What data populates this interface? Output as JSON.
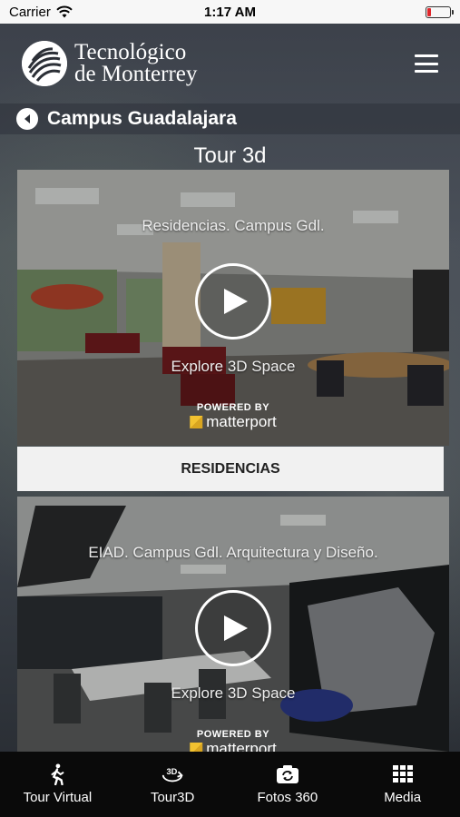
{
  "status_bar": {
    "carrier": "Carrier",
    "time": "1:17 AM"
  },
  "header": {
    "logo_line1": "Tecnológico",
    "logo_line2": "de Monterrey"
  },
  "campus": {
    "title": "Campus Guadalajara"
  },
  "section": {
    "title": "Tour 3d"
  },
  "tours": [
    {
      "caption": "Residencias. Campus Gdl.",
      "explore": "Explore 3D Space",
      "powered": "POWERED BY",
      "brand": "matterport",
      "button": "RESIDENCIAS"
    },
    {
      "caption": "EIAD. Campus Gdl. Arquitectura y Diseño.",
      "explore": "Explore 3D Space",
      "powered": "POWERED BY",
      "brand": "matterport"
    }
  ],
  "tabs": [
    {
      "label": "Tour Virtual",
      "icon": "walking-person-icon"
    },
    {
      "label": "Tour3D",
      "icon": "3d-rotate-icon"
    },
    {
      "label": "Fotos 360",
      "icon": "camera-rotate-icon"
    },
    {
      "label": "Media",
      "icon": "grid-icon"
    }
  ],
  "colors": {
    "battery_low": "#e0262b",
    "matterport_yellow": "#f2c230",
    "tab_bar": "#0a0a0a"
  }
}
